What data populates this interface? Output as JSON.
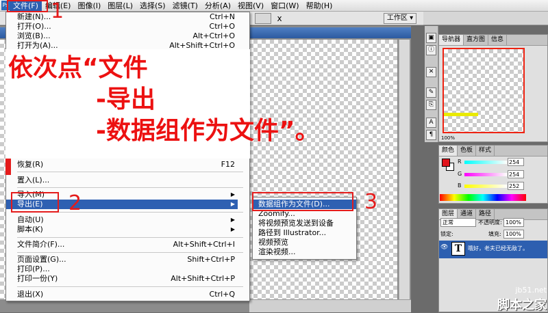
{
  "menubar": {
    "app_icon": "photoshop-logo-icon",
    "items": [
      "文件(F)",
      "编辑(E)",
      "图像(I)",
      "图层(L)",
      "选择(S)",
      "滤镜(T)",
      "分析(A)",
      "视图(V)",
      "窗口(W)",
      "帮助(H)"
    ]
  },
  "optionsbar": {
    "workspace": "工作区 ▾",
    "tool_icon": "text-orientation-icon"
  },
  "file_menu": {
    "items": [
      {
        "label": "新建(N)...",
        "shortcut": "Ctrl+N"
      },
      {
        "label": "打开(O)...",
        "shortcut": "Ctrl+O"
      },
      {
        "label": "浏览(B)...",
        "shortcut": "Alt+Ctrl+O"
      },
      {
        "label": "打开为(A)...",
        "shortcut": "Alt+Shift+Ctrl+O"
      },
      {
        "label": "恢复(R)",
        "shortcut": "F12"
      },
      {
        "label": "置入(L)...",
        "shortcut": ""
      },
      {
        "label": "导入(M)",
        "shortcut": ""
      },
      {
        "label": "导出(E)",
        "shortcut": ""
      },
      {
        "label": "自动(U)",
        "shortcut": ""
      },
      {
        "label": "脚本(K)",
        "shortcut": ""
      },
      {
        "label": "文件简介(F)...",
        "shortcut": "Alt+Shift+Ctrl+I"
      },
      {
        "label": "页面设置(G)...",
        "shortcut": "Shift+Ctrl+P"
      },
      {
        "label": "打印(P)...",
        "shortcut": ""
      },
      {
        "label": "打印一份(Y)",
        "shortcut": "Alt+Shift+Ctrl+P"
      },
      {
        "label": "退出(X)",
        "shortcut": "Ctrl+Q"
      }
    ]
  },
  "export_submenu": {
    "items": [
      "数据组作为文件(D)...",
      "Zoomify...",
      "将视频预览发送到设备",
      "路径到 Illustrator...",
      "视频预览",
      "渲染视频..."
    ]
  },
  "annotation": {
    "line1": "依次点“文件",
    "line2": "-导出",
    "line3": "-数据组作为文件”。",
    "marks": [
      "1",
      "2",
      "3"
    ],
    "color": "#ec1111"
  },
  "panels": {
    "navigator_tabs": [
      "导航器",
      "直方图",
      "信息"
    ],
    "navigator_zoom": "100%",
    "color_tabs": [
      "颜色",
      "色板",
      "样式"
    ],
    "color_channels": [
      {
        "label": "R",
        "value": "254"
      },
      {
        "label": "G",
        "value": "254"
      },
      {
        "label": "B",
        "value": "252"
      }
    ],
    "layers_tabs": [
      "图层",
      "通道",
      "路径"
    ],
    "blend_mode": "正常",
    "opacity_label": "不透明度:",
    "opacity_value": "100%",
    "lock_label": "锁定:",
    "fill_label": "填充:",
    "fill_value": "100%",
    "layer_name": "哦好，老夫已经无敌了。",
    "layer_thumb": "T"
  },
  "watermark": {
    "site": "jb51.net",
    "name": "脚本之家"
  }
}
